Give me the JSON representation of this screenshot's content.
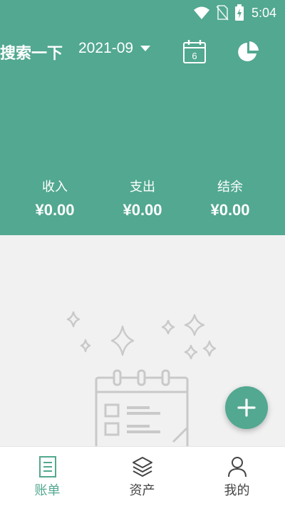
{
  "status_bar": {
    "time": "5:04",
    "icons": [
      "wifi-icon",
      "no-sim-icon",
      "battery-charging-icon"
    ]
  },
  "toolbar": {
    "title": "搜索一下",
    "month": "2021-09",
    "calendar_day": "6",
    "icons": [
      "calendar-icon",
      "pie-chart-icon",
      "dropdown-caret-icon"
    ]
  },
  "summary": {
    "income_label": "收入",
    "income_value": "¥0.00",
    "expense_label": "支出",
    "expense_value": "¥0.00",
    "balance_label": "结余",
    "balance_value": "¥0.00"
  },
  "empty_state": {
    "illustration": "empty-calendar-sparkles-illustration"
  },
  "fab": {
    "icon": "plus-icon"
  },
  "bottom_nav": {
    "items": [
      {
        "label": "账单",
        "icon": "bill-icon",
        "active": true
      },
      {
        "label": "资产",
        "icon": "layers-icon",
        "active": false
      },
      {
        "label": "我的",
        "icon": "person-icon",
        "active": false
      }
    ]
  },
  "colors": {
    "primary": "#52a890",
    "background": "#f1f1f1",
    "illustration": "#c9c9c9"
  }
}
